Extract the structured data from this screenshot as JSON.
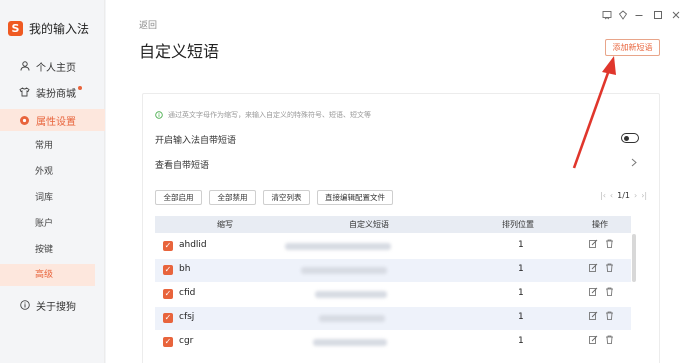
{
  "sidebar": {
    "brand": "我的输入法",
    "items": [
      {
        "label": "个人主页",
        "icon": "user-icon"
      },
      {
        "label": "装扮商城",
        "icon": "shirt-icon"
      },
      {
        "label": "属性设置",
        "icon": "settings-icon"
      },
      {
        "label": "关于搜狗",
        "icon": "info-icon"
      }
    ],
    "subitems": [
      "常用",
      "外观",
      "词库",
      "账户",
      "按键",
      "高级"
    ]
  },
  "main": {
    "back": "返回",
    "title": "自定义短语",
    "add_button": "添加新短语",
    "tip": "通过英文字母作为缩写，来输入自定义的特殊符号、短语、短文等",
    "option_enable": "开启输入法自带短语",
    "option_view": "查看自带短语",
    "actions": [
      "全部启用",
      "全部禁用",
      "清空列表",
      "直接编辑配置文件"
    ],
    "pager": {
      "current": "1/1"
    },
    "table": {
      "headers": [
        "缩写",
        "自定义短语",
        "排列位置",
        "操作"
      ],
      "rows": [
        {
          "abbr": "ahdlid",
          "order": "1"
        },
        {
          "abbr": "bh",
          "order": "1"
        },
        {
          "abbr": "cfid",
          "order": "1"
        },
        {
          "abbr": "cfsj",
          "order": "1"
        },
        {
          "abbr": "cgr",
          "order": "1"
        }
      ]
    }
  },
  "colors": {
    "accent": "#e8643c",
    "arrow": "#e0362c"
  }
}
